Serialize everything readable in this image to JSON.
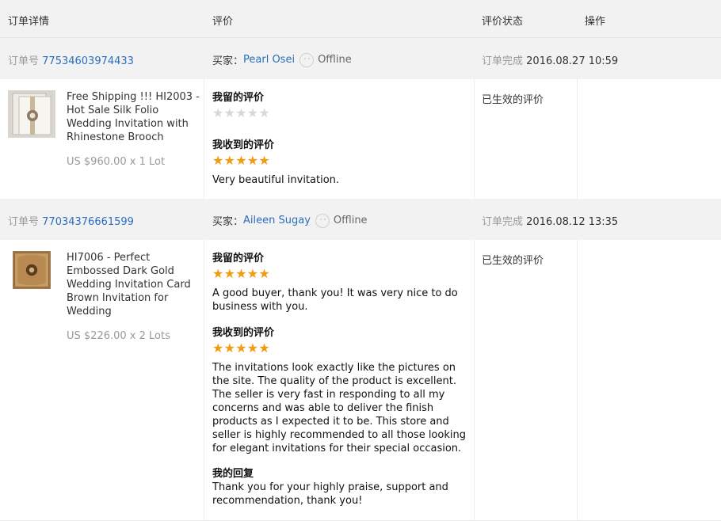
{
  "header": {
    "col_order": "订单详情",
    "col_review": "评价",
    "col_status": "评价状态",
    "col_action": "操作"
  },
  "orders": [
    {
      "order_label": "订单号",
      "order_no": "77534603974433",
      "buyer_label": "买家：",
      "buyer_name": "Pearl Osei",
      "online_status": "Offline",
      "status_label": "订单完成",
      "completed_at": "2016.08.27 10:59",
      "product_name": "Free Shipping !!! HI2003 - Hot Sale Silk Folio Wedding Invitation with Rhinestone Brooch",
      "price": "US $960.00 x 1 Lot",
      "my_review_title": "我留的评价",
      "my_rating": 0,
      "my_review_text": "",
      "received_title": "我收到的评价",
      "received_rating": 5,
      "received_text": "Very beautiful invitation.",
      "reply_title": "",
      "reply_text": "",
      "review_status": "已生效的评价"
    },
    {
      "order_label": "订单号",
      "order_no": "77034376661599",
      "buyer_label": "买家：",
      "buyer_name": "Aileen Sugay",
      "online_status": "Offline",
      "status_label": "订单完成",
      "completed_at": "2016.08.12 13:35",
      "product_name": "HI7006 - Perfect Embossed Dark Gold Wedding Invitation Card Brown Invitation for Wedding",
      "price": "US $226.00 x 2 Lots",
      "my_review_title": "我留的评价",
      "my_rating": 5,
      "my_review_text": "A good buyer, thank you! It was very nice to do business with you.",
      "received_title": "我收到的评价",
      "received_rating": 5,
      "received_text": "The invitations look exactly like the pictures on the site. The quality of the product is excellent. The seller is very fast in responding to all my concerns and was able to deliver the finish products as I expected it to be. This store and seller is highly recommended to all those looking for elegant invitations for their special occasion.",
      "reply_title": "我的回复",
      "reply_text": "Thank you for your highly praise, support and recommendation, thank you!",
      "review_status": "已生效的评价"
    }
  ],
  "colors": {
    "link": "#2a6fbd",
    "star_on": "#f29b0f",
    "star_off": "#d8d8d8",
    "bar_bg": "#f2f2f2"
  }
}
